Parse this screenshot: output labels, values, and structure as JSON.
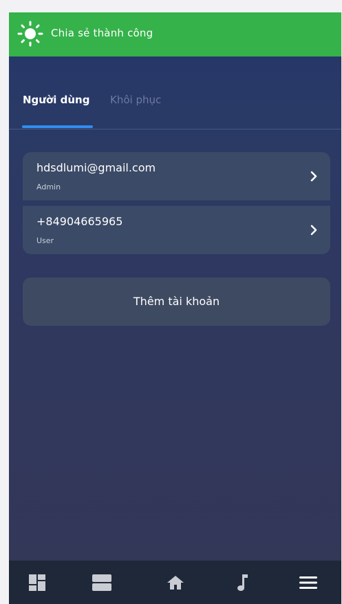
{
  "toast": {
    "icon": "sun-icon",
    "text": "Chia sẻ thành công",
    "color": "#35b24a"
  },
  "tabs": [
    {
      "label": "Người dùng",
      "active": true
    },
    {
      "label": "Khôi phục",
      "active": false
    }
  ],
  "accent_color": "#2f8df0",
  "users": [
    {
      "account": "hdsdlumi@gmail.com",
      "role": "Admin",
      "icon": "chevron-right-icon"
    },
    {
      "account": "+84904665965",
      "role": "User",
      "icon": "chevron-right-icon"
    }
  ],
  "add_account_label": "Thêm tài khoản",
  "bottom_nav": [
    {
      "icon": "dashboard-icon"
    },
    {
      "icon": "devices-icon"
    },
    {
      "icon": "home-icon"
    },
    {
      "icon": "music-icon"
    },
    {
      "icon": "menu-icon"
    }
  ]
}
